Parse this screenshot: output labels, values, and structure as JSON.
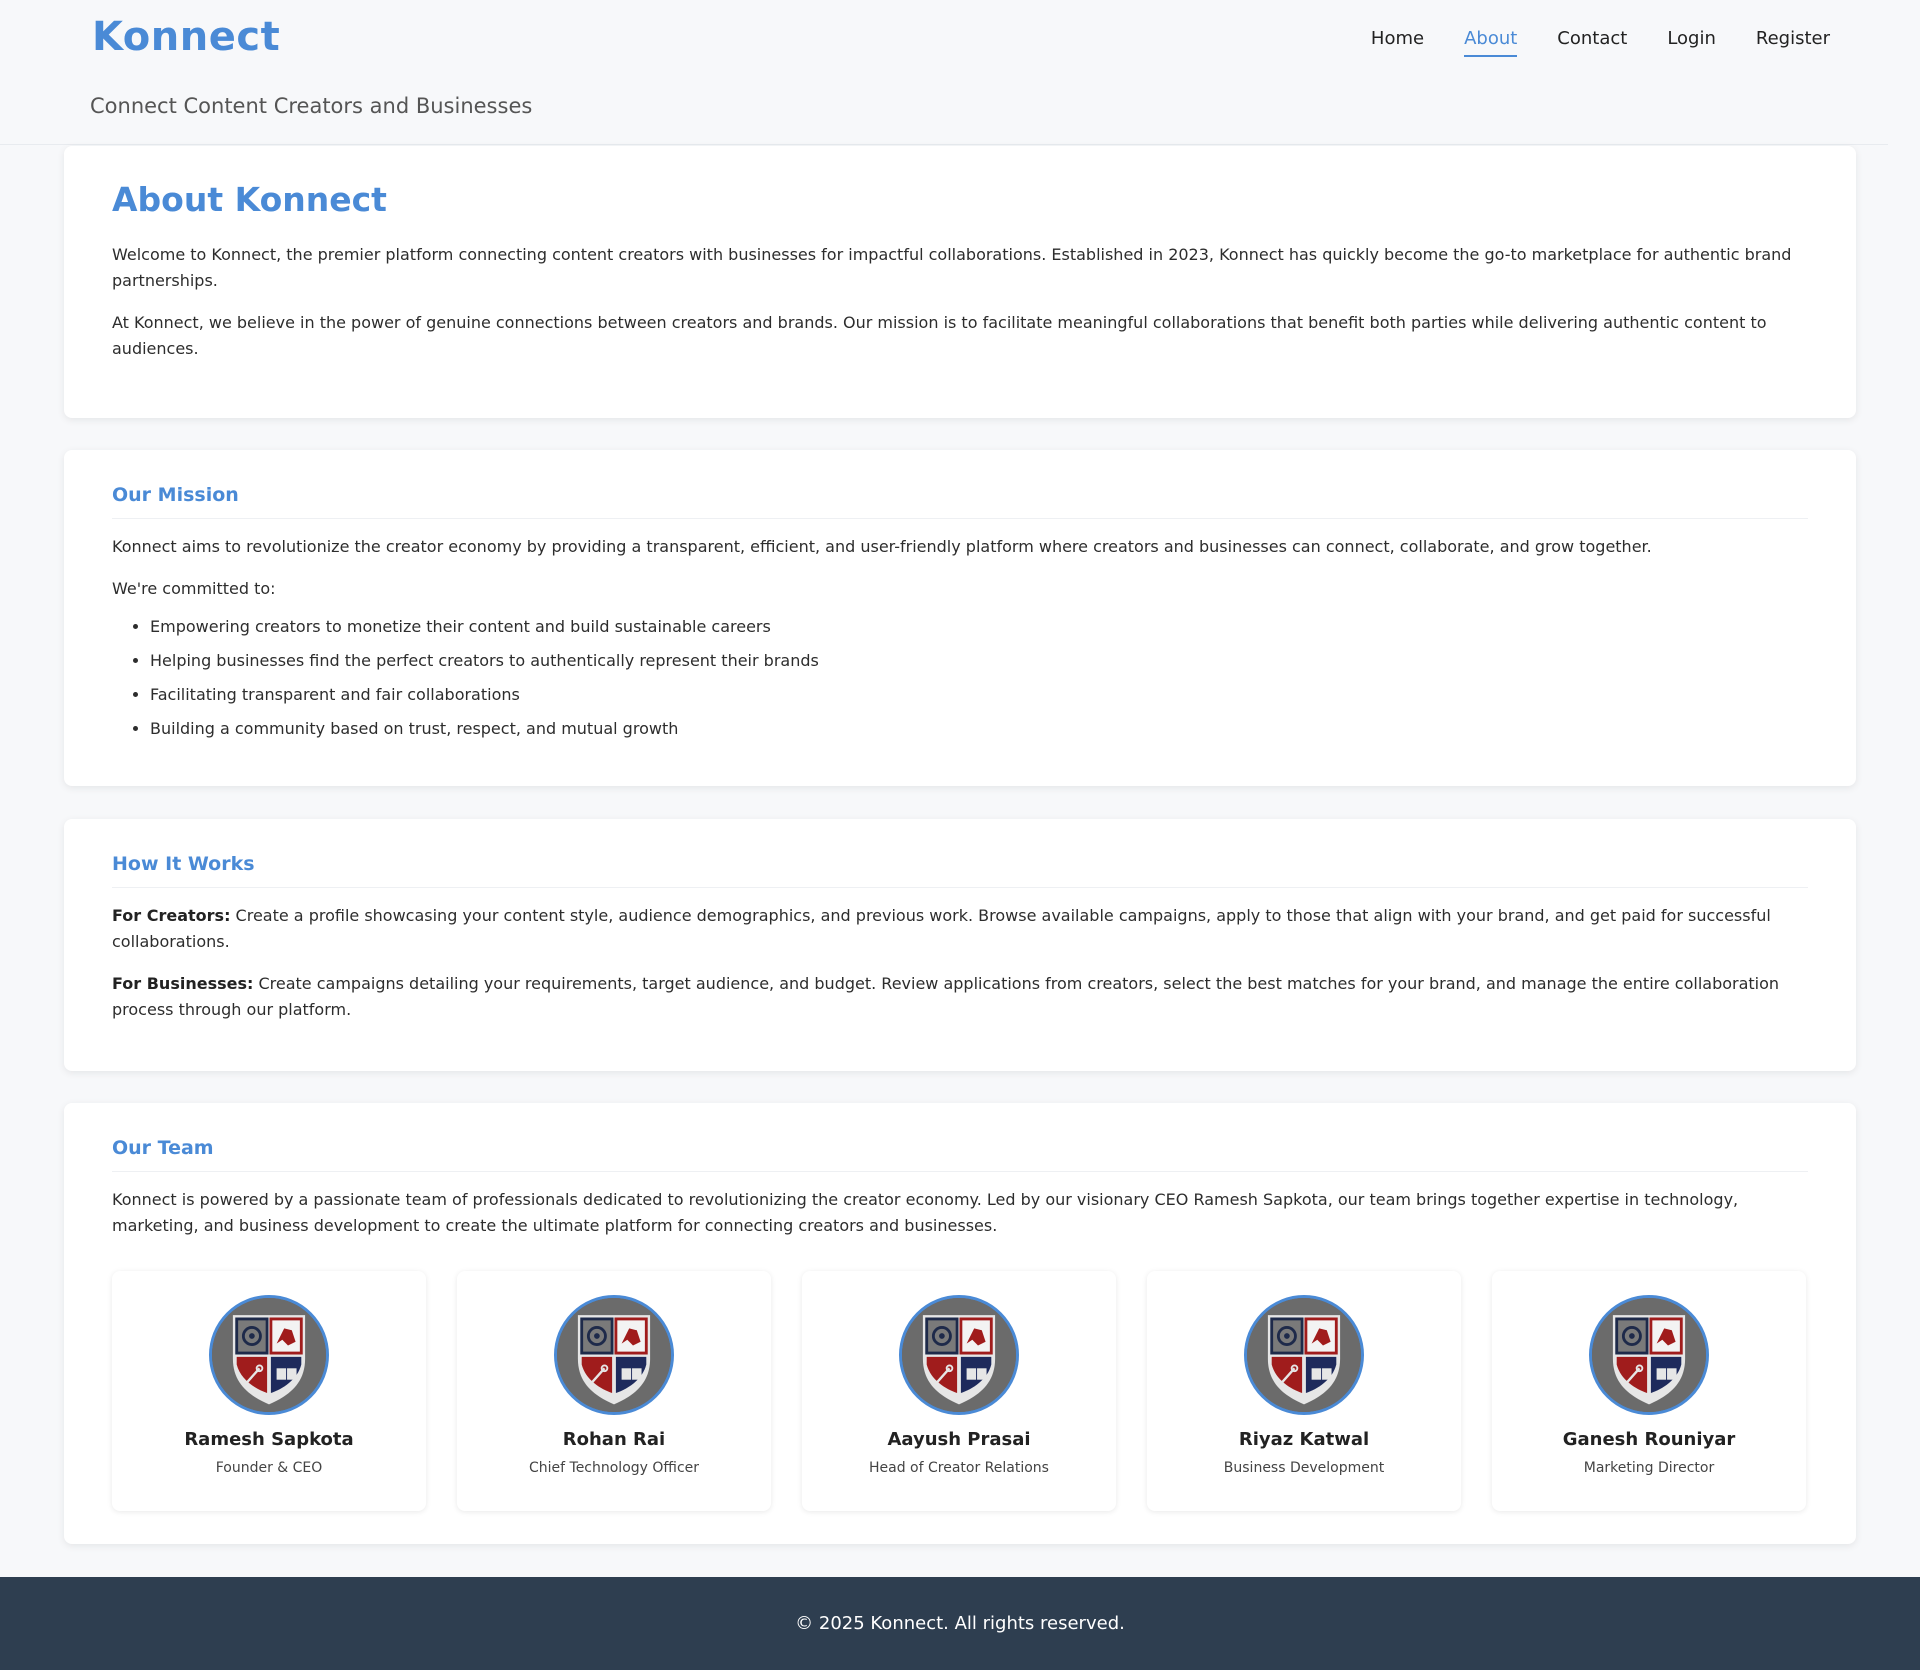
{
  "header": {
    "logo": "Konnect",
    "tagline": "Connect Content Creators and Businesses",
    "nav": [
      {
        "label": "Home",
        "active": false
      },
      {
        "label": "About",
        "active": true
      },
      {
        "label": "Contact",
        "active": false
      },
      {
        "label": "Login",
        "active": false
      },
      {
        "label": "Register",
        "active": false
      }
    ]
  },
  "about": {
    "title": "About Konnect",
    "p1": "Welcome to Konnect, the premier platform connecting content creators with businesses for impactful collaborations. Established in 2023, Konnect has quickly become the go-to marketplace for authentic brand partnerships.",
    "p2": "At Konnect, we believe in the power of genuine connections between creators and brands. Our mission is to facilitate meaningful collaborations that benefit both parties while delivering authentic content to audiences."
  },
  "mission": {
    "title": "Our Mission",
    "p1": "Konnect aims to revolutionize the creator economy by providing a transparent, efficient, and user-friendly platform where creators and businesses can connect, collaborate, and grow together.",
    "p2": "We're committed to:",
    "items": [
      "Empowering creators to monetize their content and build sustainable careers",
      "Helping businesses find the perfect creators to authentically represent their brands",
      "Facilitating transparent and fair collaborations",
      "Building a community based on trust, respect, and mutual growth"
    ]
  },
  "how": {
    "title": "How It Works",
    "creators_label": "For Creators:",
    "creators_text": " Create a profile showcasing your content style, audience demographics, and previous work. Browse available campaigns, apply to those that align with your brand, and get paid for successful collaborations.",
    "business_label": "For Businesses:",
    "business_text": " Create campaigns detailing your requirements, target audience, and budget. Review applications from creators, select the best matches for your brand, and manage the entire collaboration process through our platform."
  },
  "team": {
    "title": "Our Team",
    "intro": "Konnect is powered by a passionate team of professionals dedicated to revolutionizing the creator economy. Led by our visionary CEO Ramesh Sapkota, our team brings together expertise in technology, marketing, and business development to create the ultimate platform for connecting creators and businesses.",
    "members": [
      {
        "name": "Ramesh Sapkota",
        "role": "Founder & CEO"
      },
      {
        "name": "Rohan Rai",
        "role": "Chief Technology Officer"
      },
      {
        "name": "Aayush Prasai",
        "role": "Head of Creator Relations"
      },
      {
        "name": "Riyaz Katwal",
        "role": "Business Development"
      },
      {
        "name": "Ganesh Rouniyar",
        "role": "Marketing Director"
      }
    ]
  },
  "footer": {
    "text": "© 2025 Konnect. All rights reserved."
  },
  "colors": {
    "accent": "#4a8ad6",
    "footer_bg": "#2e3e50",
    "page_bg": "#f7f8fa"
  },
  "icons": {
    "avatar": "crest-icon"
  }
}
